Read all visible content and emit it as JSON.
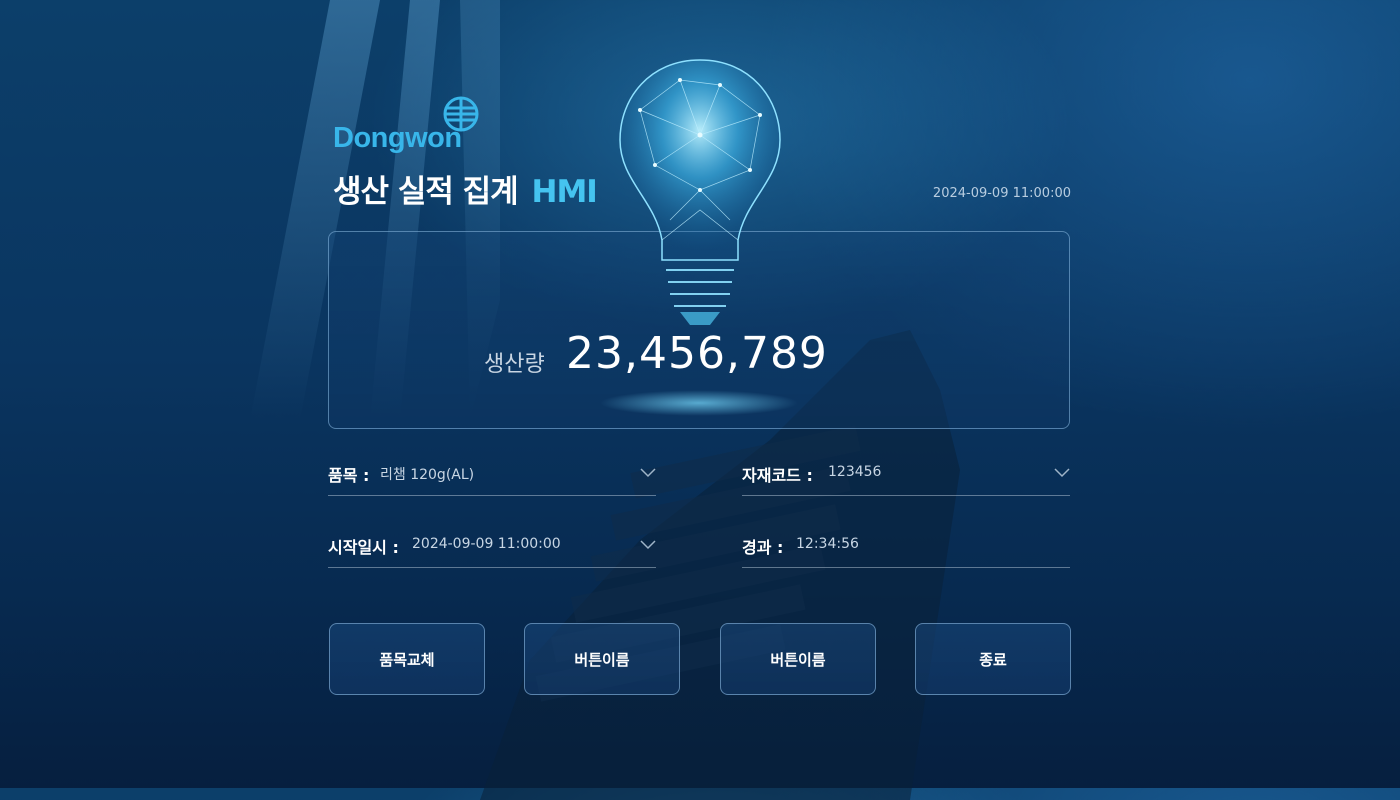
{
  "brand": {
    "logo_text": "Dongwon",
    "title_main": "생산 실적 집계",
    "title_accent": "HMI",
    "accent_color": "#38b6ea"
  },
  "header": {
    "datetime": "2024-09-09 11:00:00"
  },
  "production": {
    "label": "생산량",
    "value": "23,456,789",
    "illustration_icon": "lightbulb-icon"
  },
  "fields": {
    "item": {
      "label": "품목 :",
      "value": "리챔 120g(AL)"
    },
    "material_code": {
      "label": "자재코드 :",
      "value": "123456"
    },
    "start_time": {
      "label": "시작일시 :",
      "value": "2024-09-09 11:00:00"
    },
    "elapsed": {
      "label": "경과 :",
      "value": "12:34:56"
    }
  },
  "buttons": {
    "change_item": "품목교체",
    "button2": "버튼이름",
    "button3": "버튼이름",
    "exit": "종료"
  }
}
